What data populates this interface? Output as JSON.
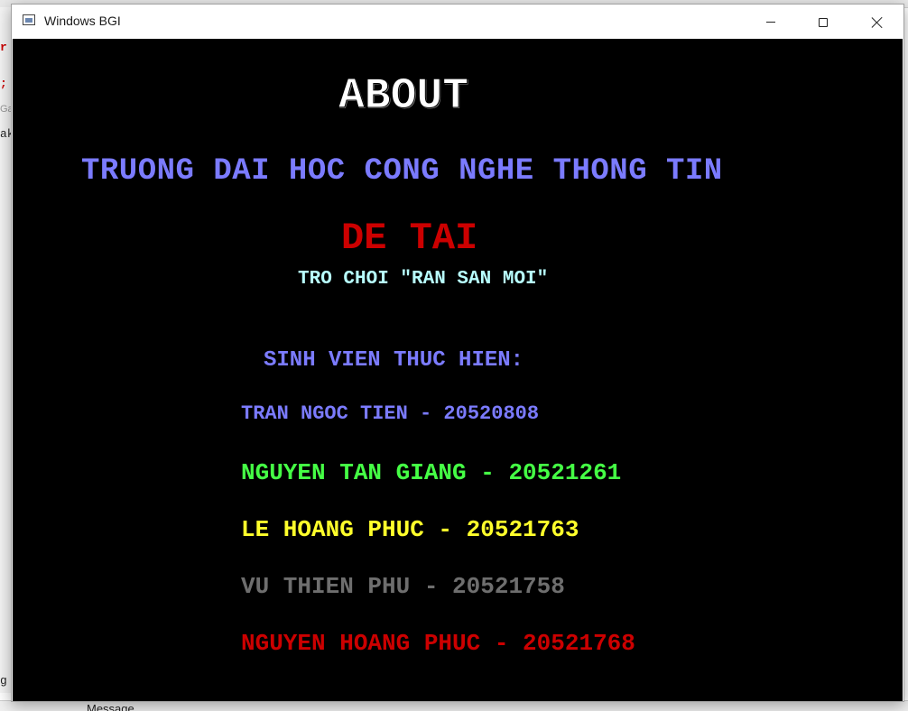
{
  "background": {
    "fragments": [
      "r",
      ";",
      "Ga",
      "ak",
      "g"
    ],
    "bottom_label": "Message"
  },
  "window": {
    "title": "Windows BGI",
    "icon": "bgi-window-icon",
    "controls": {
      "minimize_icon": "minimize-icon",
      "maximize_icon": "maximize-icon",
      "close_icon": "close-icon"
    }
  },
  "about": {
    "title": "ABOUT",
    "university": "TRUONG DAI HOC CONG NGHE THONG TIN",
    "topic_label": "DE TAI",
    "topic_name": "TRO CHOI \"RAN SAN MOI\"",
    "members_heading": "SINH VIEN THUC HIEN:",
    "members": [
      {
        "text": "TRAN NGOC TIEN - 20520808",
        "color": "#7b7bff"
      },
      {
        "text": "NGUYEN TAN GIANG - 20521261",
        "color": "#45ff45"
      },
      {
        "text": "LE HOANG PHUC - 20521763",
        "color": "#ffff2b"
      },
      {
        "text": "VU THIEN PHU - 20521758",
        "color": "#6e6e6e"
      },
      {
        "text": "NGUYEN HOANG PHUC - 20521768",
        "color": "#cc0000"
      }
    ]
  },
  "colors": {
    "canvas_background": "#000000",
    "title": "#ffffff",
    "university": "#7b7bff",
    "topic_label": "#cc0000",
    "topic_name": "#b8ffff"
  }
}
